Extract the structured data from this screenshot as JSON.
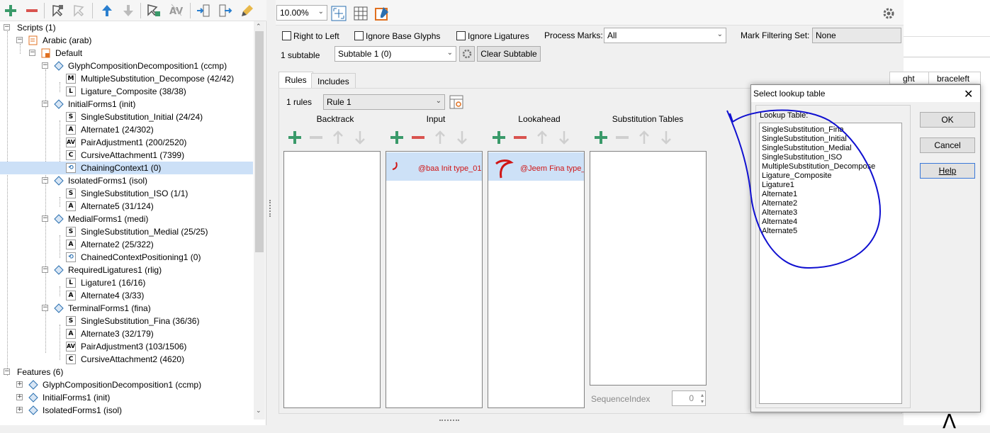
{
  "left_tree": {
    "rows": [
      {
        "label": "Scripts (1)"
      },
      {
        "label": "Arabic (arab)"
      },
      {
        "label": "Default"
      },
      {
        "label": "GlyphCompositionDecomposition1 (ccmp)"
      },
      {
        "label": "MultipleSubstitution_Decompose (42/42)",
        "glyph": "M"
      },
      {
        "label": "Ligature_Composite (38/38)",
        "glyph": "L"
      },
      {
        "label": "InitialForms1 (init)"
      },
      {
        "label": "SingleSubstitution_Initial (24/24)",
        "glyph": "S"
      },
      {
        "label": "Alternate1 (24/302)",
        "glyph": "A"
      },
      {
        "label": "PairAdjustment1 (200/2520)",
        "glyph": "AV"
      },
      {
        "label": "CursiveAttachment1 (7399)",
        "glyph": "C"
      },
      {
        "label": "ChainingContext1 (0)",
        "glyph": "chain"
      },
      {
        "label": "IsolatedForms1 (isol)"
      },
      {
        "label": "SingleSubstitution_ISO (1/1)",
        "glyph": "S"
      },
      {
        "label": "Alternate5 (31/124)",
        "glyph": "A"
      },
      {
        "label": "MedialForms1 (medi)"
      },
      {
        "label": "SingleSubstitution_Medial (25/25)",
        "glyph": "S"
      },
      {
        "label": "Alternate2 (25/322)",
        "glyph": "A"
      },
      {
        "label": "ChainedContextPositioning1 (0)",
        "glyph": "chain"
      },
      {
        "label": "RequiredLigatures1 (rlig)"
      },
      {
        "label": "Ligature1 (16/16)",
        "glyph": "L"
      },
      {
        "label": "Alternate4 (3/33)",
        "glyph": "A"
      },
      {
        "label": "TerminalForms1 (fina)"
      },
      {
        "label": "SingleSubstitution_Fina (36/36)",
        "glyph": "S"
      },
      {
        "label": "Alternate3 (32/179)",
        "glyph": "A"
      },
      {
        "label": "PairAdjustment3 (103/1506)",
        "glyph": "AV"
      },
      {
        "label": "CursiveAttachment2 (4620)",
        "glyph": "C"
      },
      {
        "label": "Features (6)"
      },
      {
        "label": "GlyphCompositionDecomposition1 (ccmp)"
      },
      {
        "label": "InitialForms1 (init)"
      },
      {
        "label": "IsolatedForms1 (isol)"
      }
    ],
    "selected": "ChainingContext1 (0)"
  },
  "toolbar": {
    "zoom": "10.00%"
  },
  "options": {
    "right_to_left": "Right to Left",
    "ignore_base": "Ignore Base Glyphs",
    "ignore_ligatures": "Ignore Ligatures",
    "process_marks_label": "Process Marks:",
    "process_marks_value": "All",
    "mark_filtering_label": "Mark Filtering Set:",
    "mark_filtering_value": "None",
    "subtable_count": "1 subtable",
    "subtable_value": "Subtable 1 (0)",
    "clear_subtable": "Clear Subtable"
  },
  "tabs": {
    "rules": "Rules",
    "includes": "Includes"
  },
  "rules": {
    "count": "1 rules",
    "current": "Rule 1",
    "col_backtrack": "Backtrack",
    "col_input": "Input",
    "col_lookahead": "Lookahead",
    "col_subst": "Substitution Tables",
    "input_entry": "@baa Init type_01",
    "lookahead_entry": "@Jeem Fina type_",
    "sequence_label": "SequenceIndex",
    "sequence_value": "0"
  },
  "behind_table": {
    "col1": "ght",
    "col2": "braceleft"
  },
  "dialog": {
    "title": "Select lookup table",
    "list_label": "Lookup Table:",
    "items": [
      "SingleSubstitution_Fina",
      "SingleSubstitution_Initial",
      "SingleSubstitution_Medial",
      "SingleSubstitution_ISO",
      "MultipleSubstitution_Decompose",
      "Ligature_Composite",
      "Ligature1",
      "Alternate1",
      "Alternate2",
      "Alternate3",
      "Alternate4",
      "Alternate5"
    ],
    "ok": "OK",
    "cancel": "Cancel",
    "help": "Help"
  },
  "colors": {
    "add": "#3a9a6a",
    "remove": "#d9534f",
    "accent": "#1a5fb4",
    "annotation": "#1010d0",
    "glyph_red": "#d01515",
    "selection": "#cce0f7"
  }
}
